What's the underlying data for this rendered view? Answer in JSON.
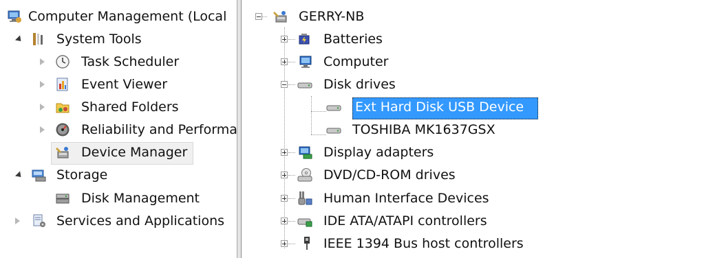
{
  "left_tree": {
    "root": "Computer Management (Local",
    "system_tools": "System Tools",
    "task_scheduler": "Task Scheduler",
    "event_viewer": "Event Viewer",
    "shared_folders": "Shared Folders",
    "reliability": "Reliability and Performa",
    "device_manager": "Device Manager",
    "storage": "Storage",
    "disk_management": "Disk Management",
    "services": "Services and Applications"
  },
  "right_tree": {
    "root": "GERRY-NB",
    "batteries": "Batteries",
    "computer": "Computer",
    "disk_drives": "Disk drives",
    "ext_hard_disk": "Ext Hard Disk USB Device",
    "toshiba": "TOSHIBA MK1637GSX",
    "display_adapters": "Display adapters",
    "dvd_drives": "DVD/CD-ROM drives",
    "hid": "Human Interface Devices",
    "ide": "IDE ATA/ATAPI controllers",
    "ieee1394": "IEEE 1394 Bus host controllers"
  },
  "colors": {
    "selection": "#3399ff",
    "selection_text": "#ffffff"
  }
}
